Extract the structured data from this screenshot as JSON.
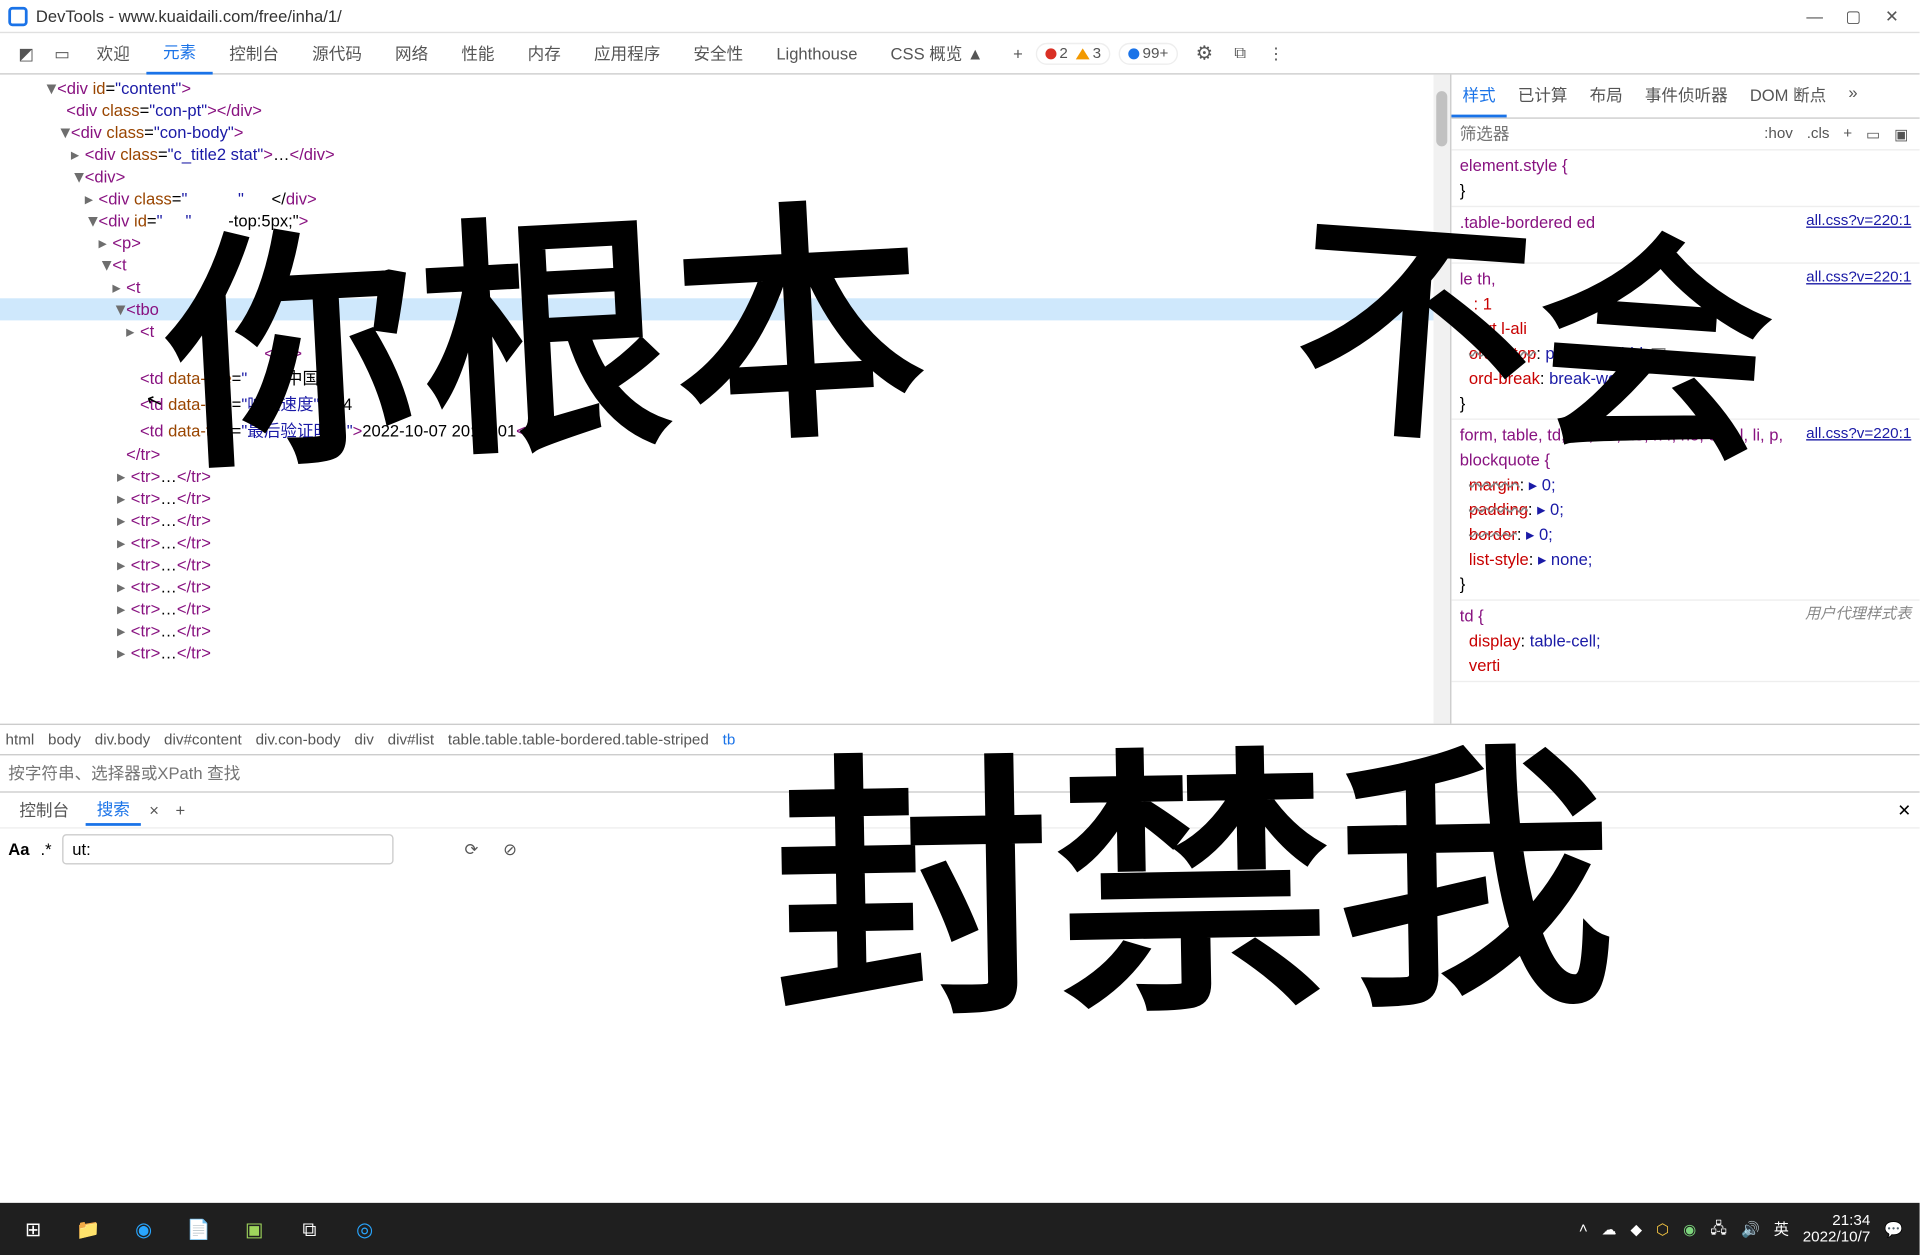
{
  "window": {
    "title": "DevTools - www.kuaidaili.com/free/inha/1/"
  },
  "tabs": {
    "welcome": "欢迎",
    "elements": "元素",
    "console": "控制台",
    "sources": "源代码",
    "network": "网络",
    "performance": "性能",
    "memory": "内存",
    "application": "应用程序",
    "security": "安全性",
    "lighthouse": "Lighthouse",
    "cssOverview": "CSS 概览 ▲"
  },
  "badges": {
    "errors": "2",
    "warnings": "3",
    "info": "99+"
  },
  "dom": {
    "l1": "<div id=\"content\">",
    "l2": "<div class=\"con-pt\"></div>",
    "l3": "<div class=\"con-body\">",
    "l4": "<div class=\"c_title2 stat\">…</div>",
    "l5": "<div>",
    "l6": "<div class=\"            \"></div>",
    "l7": "<div id=\"         \" style=\"  -top:5px;\">",
    "l8": "<p>",
    "l9": "<t ",
    "l10": "<t ",
    "l11": "<tbo ",
    "l12": "<t ",
    "l13": "         </td>",
    "l14": "<td data-title=\"     \">中国 山       </td>",
    "l15": "<td data-title=\"响应速度\">0.4     </td>",
    "l16": "<td data-title=\"最后验证时间\">2022-10-07 20:31:01</t",
    "l17": "</tr>",
    "tr": "<tr>…</tr>"
  },
  "crumbs": [
    "html",
    "body",
    "div.body",
    "div#content",
    "div.con-body",
    "div",
    "div#list",
    "table.table.table-bordered.table-striped",
    "tb"
  ],
  "elementsSearch": {
    "placeholder": "按字符串、选择器或XPath 查找"
  },
  "styles": {
    "tabs": {
      "styles": "样式",
      "computed": "已计算",
      "layout": "布局",
      "eventListeners": "事件侦听器",
      "domBreakpoints": "DOM 断点"
    },
    "filter": "筛选器",
    "hov": ":hov",
    "cls": ".cls",
    "r1": "element.style {",
    "r2s": ".table-bordered            ed",
    "src": "all.css?v=220:1",
    "r3": "                -]",
    "r4": "   le th,",
    "r4src": "all.css?v=220:1",
    "p1": "     : 1",
    "p2": "vert   l-ali",
    "p3n": "order-top",
    "p3v": "  px solid #ddd;",
    "p4n": "ord-break",
    "p4v": "break-word;",
    "r5": "form, table, td, h1, h2, h3, h4, h5, ul, ol, li, p, blockquote {",
    "r5src": "all.css?v=220:1",
    "p5n": "margin",
    "p5v": "▸ 0;",
    "p6n": "padding",
    "p6v": "▸ 0;",
    "p7n": "border",
    "p7v": "▸ 0;",
    "p8n": "list-style",
    "p8v": "▸ none;",
    "r6": "td {",
    "ua": "用户代理样式表",
    "p9n": "display",
    "p9v": "table-cell;",
    "p10n": "verti"
  },
  "consoleTabs": {
    "console": "控制台",
    "search": "搜索"
  },
  "searchTool": {
    "aa": "Aa",
    "regex": ".*",
    "value": "ut:"
  },
  "taskbar": {
    "ime": "英",
    "time": "21:34",
    "date": "2022/10/7"
  },
  "overlay": {
    "t1": "你根本",
    "t2": "不会",
    "t3": "封禁我"
  }
}
